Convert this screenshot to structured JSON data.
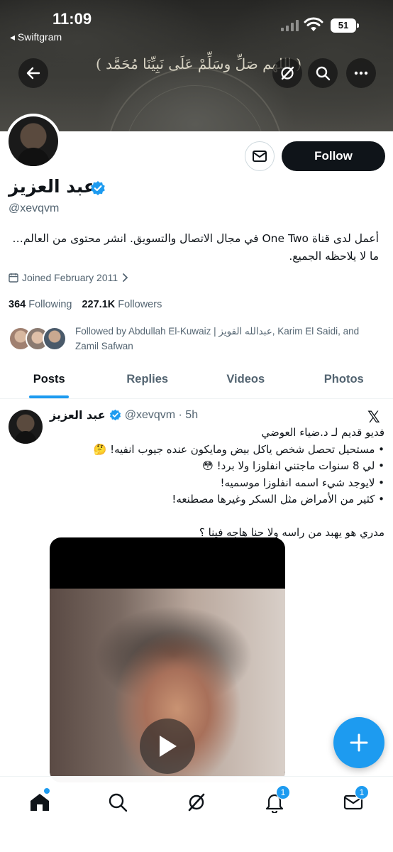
{
  "status_bar": {
    "time": "11:09",
    "back_app": "◂ Swiftgram",
    "battery": "51"
  },
  "banner": {
    "calligraphy": "( اللهم صَلِّ وسَلِّمْ عَلَى نَبِيِّنَا مُحَمَّد )"
  },
  "header_actions": {
    "back_icon": "arrow-left-icon",
    "grok_icon": "grok-icon",
    "search_icon": "search-icon",
    "more_icon": "more-icon"
  },
  "profile": {
    "display_name": "عبد العزيز",
    "handle": "@xevqvm",
    "bio": "أعمل لدى قناة One Two في مجال الاتصال والتسويق. انشر محتوى من العالم… ما لا يلاحظه الجميع.",
    "joined": "Joined February 2011",
    "following_count": "364",
    "following_label": "Following",
    "followers_count": "227.1K",
    "followers_label": "Followers",
    "followed_by": "Followed by Abdullah El-Kuwaiz | عبدالله القويز, Karim El Saidi, and Zamil Safwan",
    "follow_button": "Follow"
  },
  "tabs": [
    {
      "label": "Posts",
      "active": true
    },
    {
      "label": "Replies",
      "active": false
    },
    {
      "label": "Videos",
      "active": false
    },
    {
      "label": "Photos",
      "active": false
    }
  ],
  "tweet": {
    "author": "عبد العزيز",
    "handle_time": "@xevqvm · 5h",
    "lines": [
      "فديو  قديم لـ د.ضياء العوضي",
      "• مستحيل تحصل شخص ياكل بيض ومايكون عنده جيوب انفيه! 🤔",
      "• لي 8 سنوات ماجتني انفلوزا ولا برد! 😳",
      "• لايوجد شيء اسمه انفلوزا موسميه!",
      "• كثير من الأمراض مثل السكر وغيرها مصطنعه!"
    ],
    "closing": "مدري هو يهبد من راسه ولا حنا هاجه فينا ؟"
  },
  "bottom_nav": {
    "notifications_badge": "1",
    "messages_badge": "1"
  },
  "colors": {
    "accent": "#1d9bf0",
    "text": "#0f1419",
    "muted": "#536471"
  }
}
